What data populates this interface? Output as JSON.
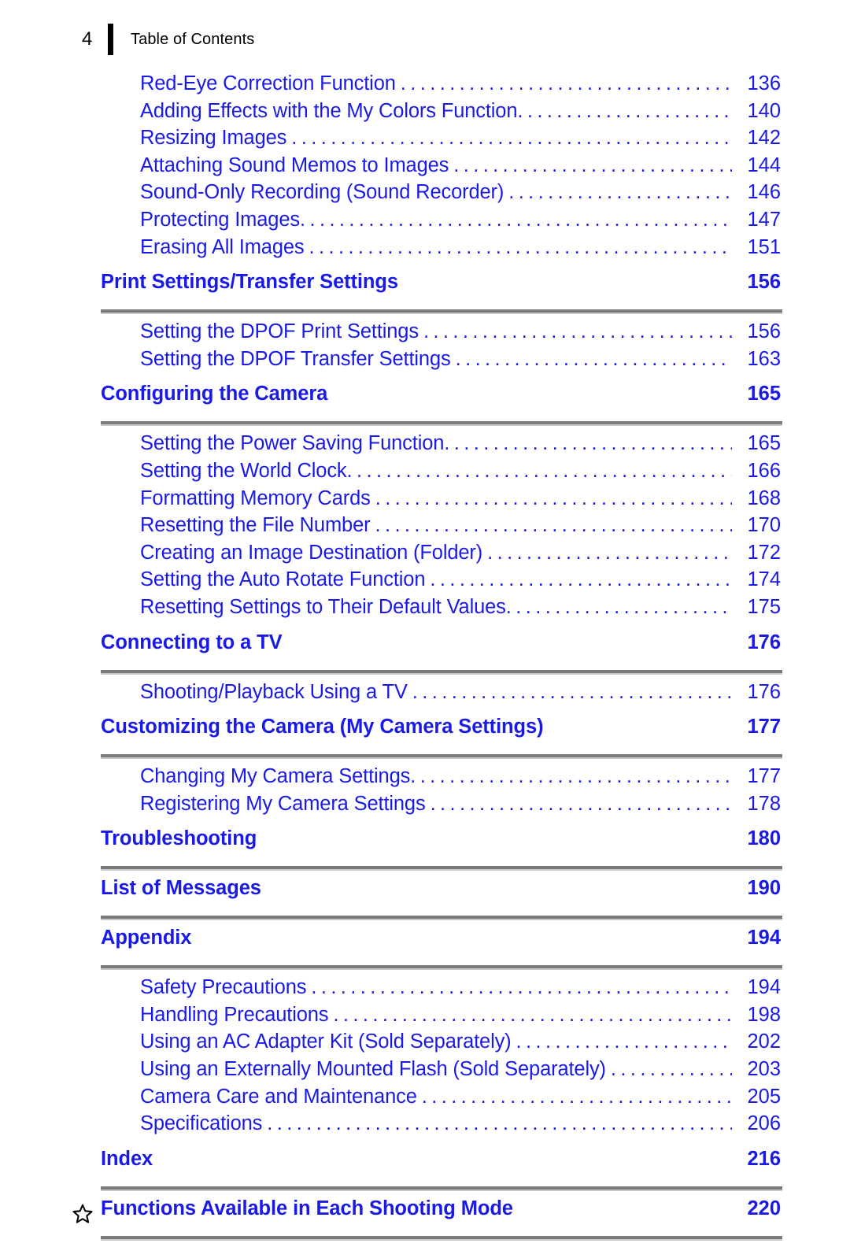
{
  "header": {
    "folio": "4",
    "title": "Table of Contents"
  },
  "theme": {
    "link_blue": "#1a1ae8",
    "rule_gray": "#7b7b7b",
    "text_black": "#000000"
  },
  "toc": {
    "blocks": [
      {
        "kind": "entries",
        "entries": [
          {
            "label": "Red-Eye Correction Function",
            "page": "136",
            "tight": false
          },
          {
            "label": "Adding Effects with the My Colors Function",
            "page": "140",
            "tight": true
          },
          {
            "label": "Resizing Images",
            "page": "142",
            "tight": false
          },
          {
            "label": "Attaching Sound Memos to Images",
            "page": "144",
            "tight": false
          },
          {
            "label": "Sound-Only Recording (Sound Recorder)",
            "page": "146",
            "tight": false
          },
          {
            "label": "Protecting Images",
            "page": "147",
            "tight": true
          },
          {
            "label": "Erasing All Images",
            "page": "151",
            "tight": false
          }
        ]
      },
      {
        "kind": "section",
        "label": "Print Settings/Transfer Settings",
        "page": "156",
        "star": false,
        "entries": [
          {
            "label": "Setting the DPOF Print Settings",
            "page": "156",
            "tight": false
          },
          {
            "label": "Setting the DPOF Transfer Settings",
            "page": "163",
            "tight": false
          }
        ]
      },
      {
        "kind": "section",
        "label": "Configuring the Camera",
        "page": "165",
        "star": false,
        "entries": [
          {
            "label": "Setting the Power Saving Function",
            "page": "165",
            "tight": true
          },
          {
            "label": "Setting the World Clock",
            "page": "166",
            "tight": true
          },
          {
            "label": "Formatting Memory Cards",
            "page": "168",
            "tight": false
          },
          {
            "label": "Resetting the File Number",
            "page": "170",
            "tight": false
          },
          {
            "label": "Creating an Image Destination (Folder)",
            "page": "172",
            "tight": false
          },
          {
            "label": "Setting the Auto Rotate Function",
            "page": "174",
            "tight": false
          },
          {
            "label": "Resetting Settings to Their Default Values",
            "page": "175",
            "tight": true
          }
        ]
      },
      {
        "kind": "section",
        "label": "Connecting to a TV",
        "page": "176",
        "star": false,
        "entries": [
          {
            "label": "Shooting/Playback Using a TV",
            "page": "176",
            "tight": false
          }
        ]
      },
      {
        "kind": "section",
        "label": "Customizing the Camera (My Camera Settings)",
        "page": "177",
        "star": false,
        "entries": [
          {
            "label": "Changing My Camera Settings",
            "page": "177",
            "tight": true
          },
          {
            "label": "Registering My Camera Settings",
            "page": "178",
            "tight": false
          }
        ]
      },
      {
        "kind": "section",
        "label": "Troubleshooting",
        "page": "180",
        "star": false,
        "entries": []
      },
      {
        "kind": "section",
        "label": "List of Messages",
        "page": "190",
        "star": false,
        "entries": []
      },
      {
        "kind": "section",
        "label": "Appendix",
        "page": "194",
        "star": false,
        "entries": [
          {
            "label": "Safety Precautions",
            "page": "194",
            "tight": false
          },
          {
            "label": "Handling Precautions",
            "page": "198",
            "tight": false
          },
          {
            "label": "Using an AC Adapter Kit (Sold Separately)",
            "page": "202",
            "tight": false
          },
          {
            "label": "Using an Externally Mounted Flash (Sold Separately)",
            "page": "203",
            "tight": false
          },
          {
            "label": "Camera Care and Maintenance",
            "page": "205",
            "tight": false
          },
          {
            "label": "Specifications",
            "page": "206",
            "tight": false
          }
        ]
      },
      {
        "kind": "section",
        "label": "Index",
        "page": "216",
        "star": false,
        "entries": []
      },
      {
        "kind": "section",
        "label": "Functions Available in Each Shooting Mode",
        "page": "220",
        "star": true,
        "star_icon": "star-outline-icon",
        "entries": []
      }
    ]
  }
}
